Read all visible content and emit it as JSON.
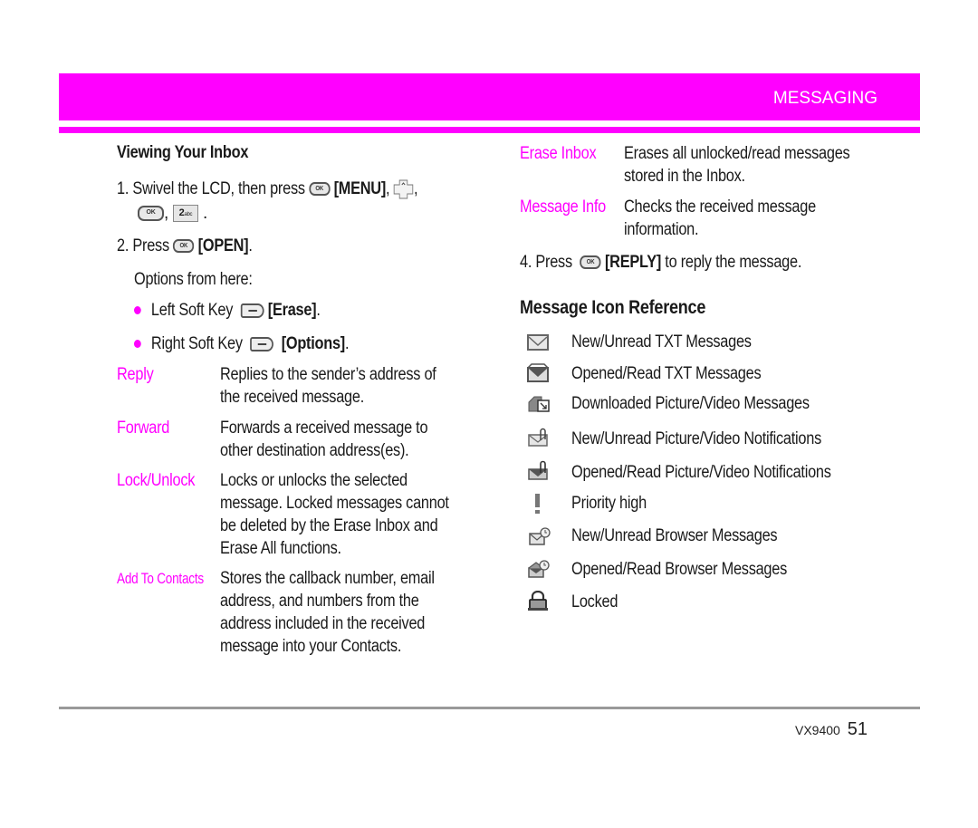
{
  "header": {
    "section_title": "MESSAGING",
    "accent_color": "#ff00ff"
  },
  "left": {
    "heading": "Viewing Your Inbox",
    "step1": {
      "number": "1.",
      "text": "Swivel the LCD, then press",
      "menu_label": "[MENU]",
      "sep1": ",",
      "sep2": ",",
      "end": ".",
      "ok_icon": "ok-key-icon",
      "nav_icon": "nav-up-key-icon",
      "two_key": {
        "digit": "2",
        "letters": "abc"
      }
    },
    "step2": {
      "number": "2.",
      "text": "Press",
      "open_label": "[OPEN]",
      "end": "."
    },
    "options_intro": "Options from here:",
    "soft_keys": [
      {
        "text": "Left Soft Key",
        "label": "[Erase]",
        "end": "."
      },
      {
        "text": "Right Soft Key",
        "label": "[Options]",
        "end": "."
      }
    ],
    "options": [
      {
        "term": "Reply",
        "desc": [
          "Replies to the sender’s address of",
          "the received message."
        ]
      },
      {
        "term": "Forward",
        "desc": [
          "Forwards a received message to",
          "other destination address(es)."
        ]
      },
      {
        "term": "Lock/Unlock",
        "desc": [
          "Locks or unlocks the selected",
          "message. Locked messages cannot",
          "be deleted by the Erase Inbox and",
          "Erase All functions."
        ]
      },
      {
        "term": "Add To Contacts",
        "desc": [
          "Stores the callback number, email",
          "address, and numbers from the",
          "address included in the received",
          "message into your Contacts."
        ]
      }
    ]
  },
  "right": {
    "options": [
      {
        "term": "Erase Inbox",
        "desc": [
          "Erases all unlocked/read messages",
          "stored in the Inbox."
        ]
      },
      {
        "term": "Message Info",
        "desc": [
          "Checks the received message",
          "information."
        ]
      }
    ],
    "step4": {
      "number": "4.",
      "text": "Press",
      "reply_label": "[REPLY]",
      "tail": "to reply the message."
    },
    "icon_heading": "Message Icon Reference",
    "icons": [
      {
        "icon": "envelope-closed-icon",
        "label": "New/Unread TXT Messages"
      },
      {
        "icon": "envelope-open-icon",
        "label": "Opened/Read TXT Messages"
      },
      {
        "icon": "download-picture-icon",
        "label": "Downloaded Picture/Video Messages"
      },
      {
        "icon": "envelope-clip-icon",
        "label": "New/Unread Picture/Video Notifications"
      },
      {
        "icon": "envelope-open-clip-icon",
        "label": "Opened/Read Picture/Video Notifications"
      },
      {
        "icon": "priority-high-icon",
        "label": "Priority high"
      },
      {
        "icon": "browser-message-icon",
        "label": "New/Unread Browser Messages"
      },
      {
        "icon": "browser-message-open-icon",
        "label": "Opened/Read Browser Messages"
      },
      {
        "icon": "lock-icon",
        "label": "Locked"
      }
    ]
  },
  "footer": {
    "model": "VX9400",
    "page_number": "51"
  }
}
